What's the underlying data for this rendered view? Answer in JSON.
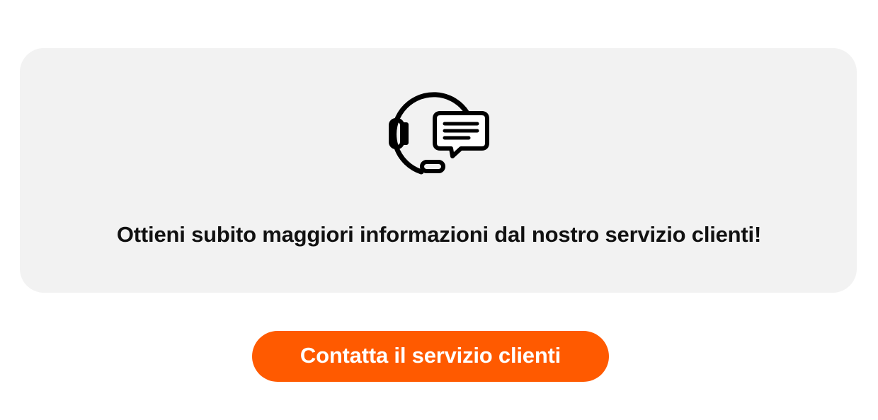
{
  "card": {
    "icon": "customer-service-headset-chat-icon",
    "message": "Ottieni subito maggiori informazioni dal nostro servizio clienti!"
  },
  "cta": {
    "label": "Contatta il servizio clienti"
  },
  "colors": {
    "card_background": "#f2f2f2",
    "button_background": "#ff5a00",
    "button_text": "#ffffff",
    "text": "#111111"
  }
}
